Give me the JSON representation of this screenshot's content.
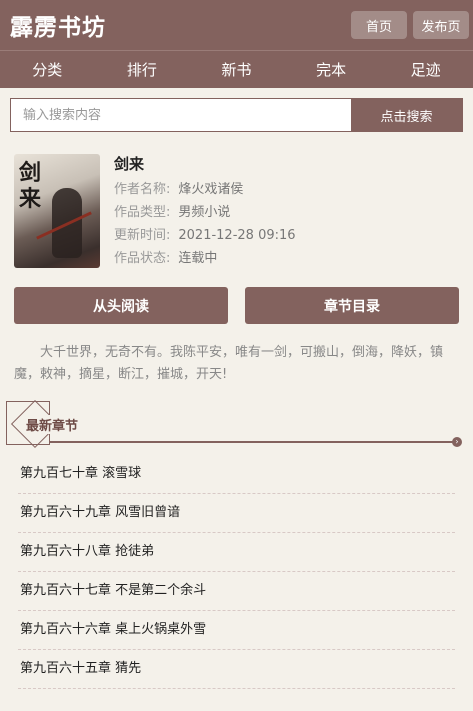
{
  "header": {
    "logo": "霹雳书坊",
    "home_label": "首页",
    "publish_label": "发布页"
  },
  "nav": [
    "分类",
    "排行",
    "新书",
    "完本",
    "足迹"
  ],
  "search": {
    "placeholder": "输入搜索内容",
    "button_label": "点击搜索"
  },
  "book": {
    "cover_title": "剑来",
    "title": "剑来",
    "author_label": "作者名称:",
    "author": "烽火戏诸侯",
    "type_label": "作品类型:",
    "type": "男频小说",
    "updated_label": "更新时间:",
    "updated": "2021-12-28 09:16",
    "status_label": "作品状态:",
    "status": "连载中"
  },
  "actions": {
    "read_label": "从头阅读",
    "toc_label": "章节目录"
  },
  "intro": "大千世界，无奇不有。我陈平安，唯有一剑，可搬山，倒海，降妖，镇魔，敕神，摘星，断江，摧城，开天!",
  "latest": {
    "title": "最新章节",
    "chapters": [
      "第九百七十章 滚雪球",
      "第九百六十九章 风雪旧曾谙",
      "第九百六十八章 抢徒弟",
      "第九百六十七章 不是第二个余斗",
      "第九百六十六章 桌上火锅桌外雪",
      "第九百六十五章 猜先"
    ]
  }
}
